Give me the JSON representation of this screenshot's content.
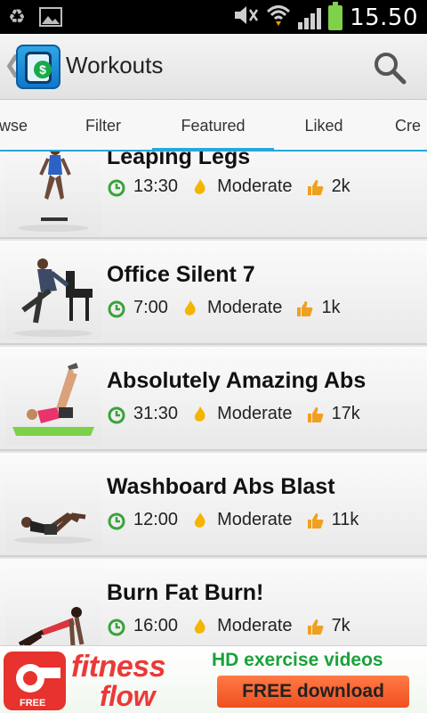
{
  "status_bar": {
    "time": "15.50"
  },
  "action_bar": {
    "title": "Workouts",
    "back_glyph": "❮"
  },
  "tabs": [
    {
      "label": "wse"
    },
    {
      "label": "Filter"
    },
    {
      "label": "Featured",
      "active": true
    },
    {
      "label": "Liked"
    },
    {
      "label": "Cre"
    }
  ],
  "workouts": [
    {
      "title": "Leaping Legs",
      "duration": "13:30",
      "difficulty": "Moderate",
      "likes": "2k"
    },
    {
      "title": "Office Silent 7",
      "duration": "7:00",
      "difficulty": "Moderate",
      "likes": "1k"
    },
    {
      "title": "Absolutely Amazing Abs",
      "duration": "31:30",
      "difficulty": "Moderate",
      "likes": "17k"
    },
    {
      "title": "Washboard Abs Blast",
      "duration": "12:00",
      "difficulty": "Moderate",
      "likes": "11k"
    },
    {
      "title": "Burn Fat Burn!",
      "duration": "16:00",
      "difficulty": "Moderate",
      "likes": "7k"
    }
  ],
  "icons": {
    "duration": "clock-icon",
    "difficulty": "flame-icon",
    "likes": "thumbs-up-icon"
  },
  "ad": {
    "brand_line1": "fitness",
    "brand_line2": "flow",
    "badge": "FREE",
    "tagline": "HD exercise videos",
    "cta": "FREE download"
  },
  "colors": {
    "accent": "#27a7de",
    "ad_red": "#ea3a38",
    "ad_green": "#19a23b"
  }
}
